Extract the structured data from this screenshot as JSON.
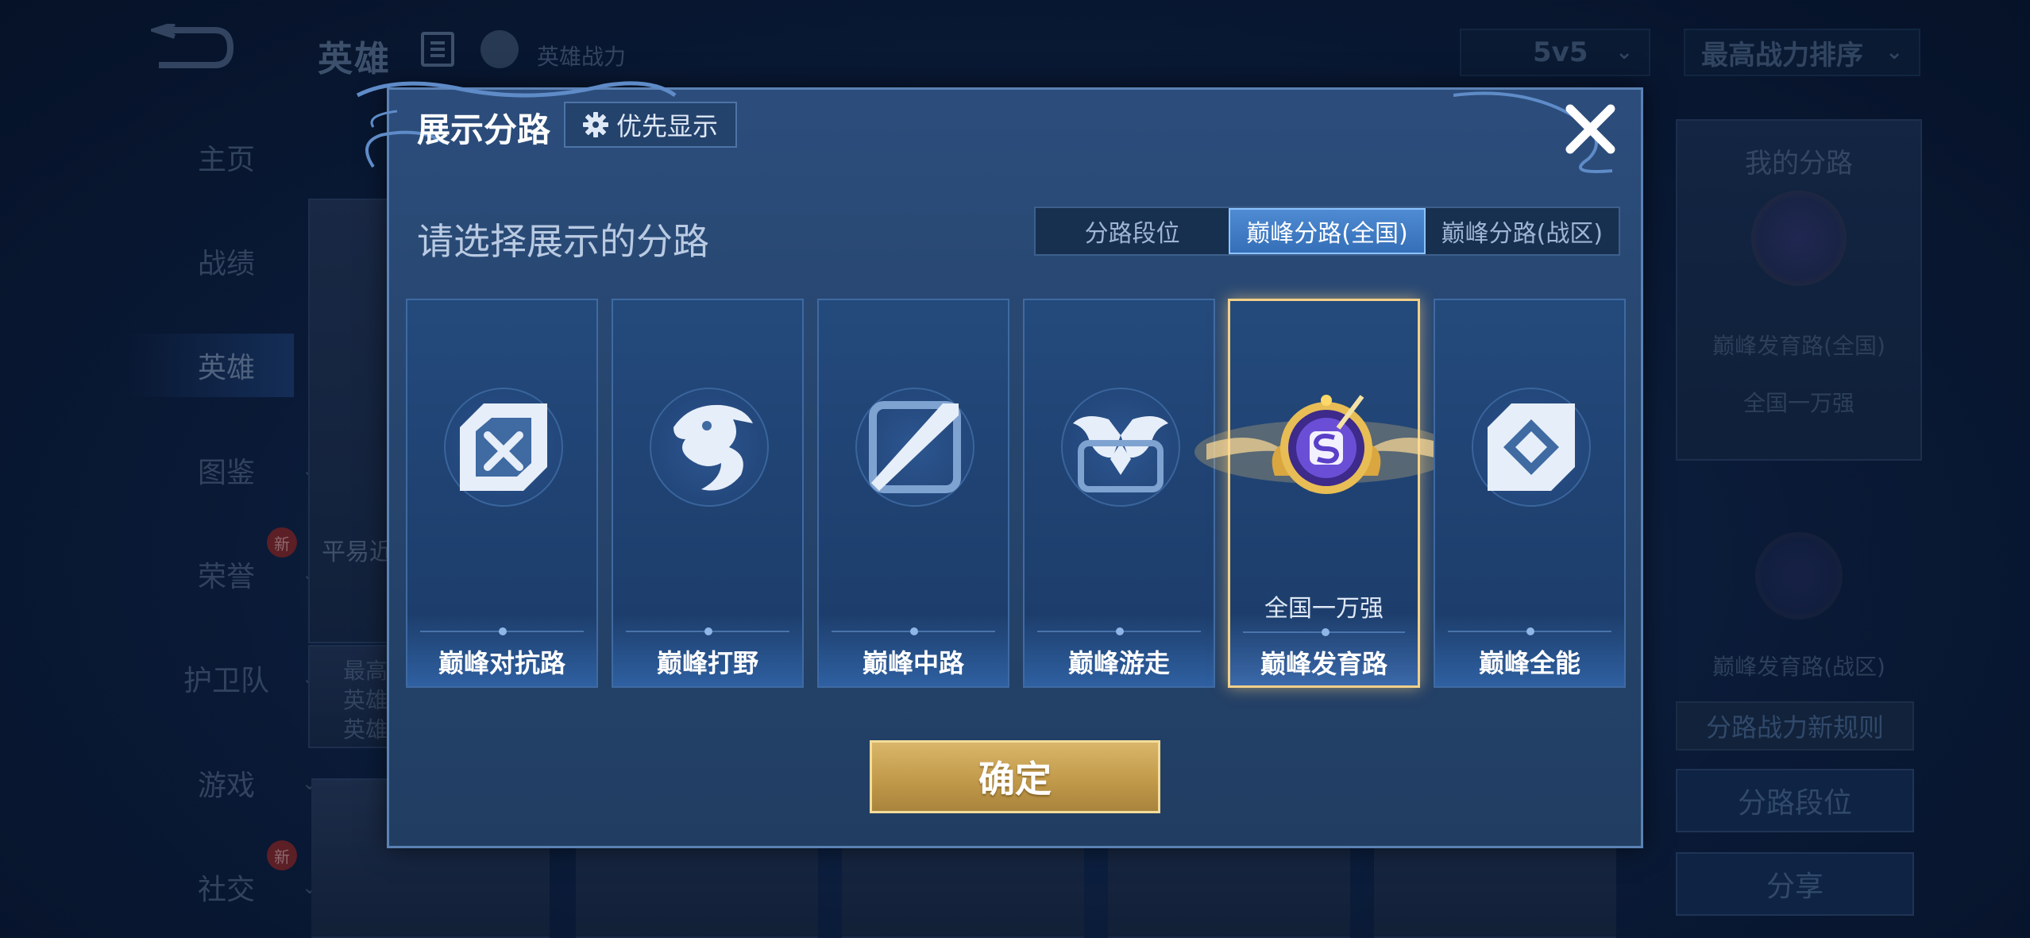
{
  "background": {
    "app_title": "英雄",
    "power_label": "英雄战力",
    "mode_dropdown": "5v5",
    "sort_dropdown": "最高战力排序",
    "sidebar": [
      {
        "label": "主页"
      },
      {
        "label": "战绩"
      },
      {
        "label": "英雄"
      },
      {
        "label": "图鉴"
      },
      {
        "label": "荣誉",
        "badge": "新"
      },
      {
        "label": "护卫队"
      },
      {
        "label": "游戏"
      },
      {
        "label": "社交",
        "badge": "新"
      }
    ],
    "hero_card": {
      "name": "平易近",
      "lines": [
        "最高",
        "英雄",
        "英雄"
      ]
    },
    "right_panel": {
      "title": "我的分路",
      "lane_national": "巅峰发育路(全国)",
      "rank_national": "全国一万强",
      "lane_zone": "巅峰发育路(战区)",
      "rules_button": "分路战力新规则",
      "rank_button": "分路段位",
      "share_button": "分享"
    }
  },
  "dialog": {
    "title": "展示分路",
    "priority_button": "优先显示",
    "subtitle": "请选择展示的分路",
    "tabs": [
      {
        "label": "分路段位",
        "active": false
      },
      {
        "label": "巅峰分路(全国)",
        "active": true
      },
      {
        "label": "巅峰分路(战区)",
        "active": false
      }
    ],
    "lanes": [
      {
        "name": "巅峰对抗路",
        "icon": "sword-shield-icon",
        "rank": ""
      },
      {
        "name": "巅峰打野",
        "icon": "dragon-icon",
        "rank": ""
      },
      {
        "name": "巅峰中路",
        "icon": "staff-icon",
        "rank": ""
      },
      {
        "name": "巅峰游走",
        "icon": "wings-icon",
        "rank": ""
      },
      {
        "name": "巅峰发育路",
        "icon": "golden-emblem-icon",
        "rank": "全国一万强",
        "selected": true
      },
      {
        "name": "巅峰全能",
        "icon": "diamond-icon",
        "rank": ""
      }
    ],
    "confirm_button": "确定"
  },
  "colors": {
    "accent_gold": "#c29a4b",
    "tab_active": "#346fb8",
    "dialog_bg": "#27466f"
  }
}
